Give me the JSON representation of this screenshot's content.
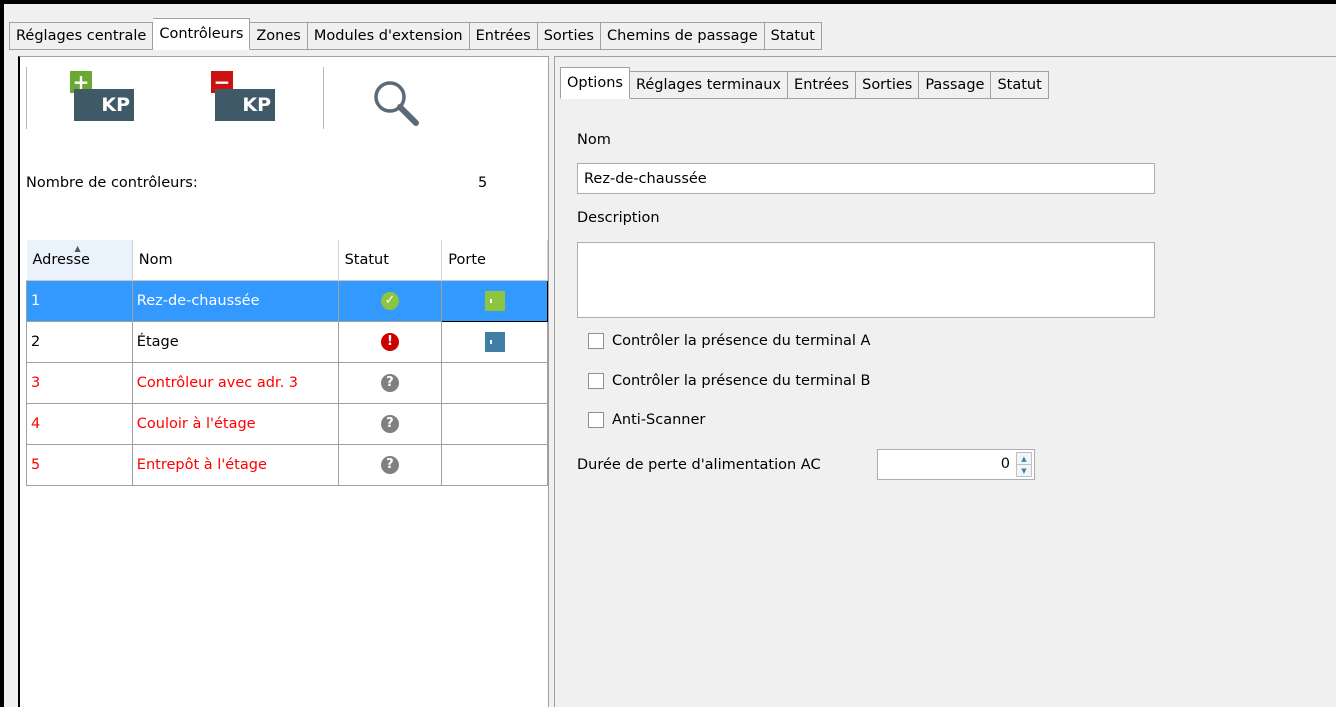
{
  "top_tabs": [
    {
      "label": "Réglages centrale"
    },
    {
      "label": "Contrôleurs"
    },
    {
      "label": "Zones"
    },
    {
      "label": "Modules d'extension"
    },
    {
      "label": "Entrées"
    },
    {
      "label": "Sorties"
    },
    {
      "label": "Chemins de passage"
    },
    {
      "label": "Statut"
    }
  ],
  "toolbar": {
    "add_badge": "+",
    "remove_badge": "−",
    "kp_text": "KP",
    "add_icon": "add-keypad-icon",
    "remove_icon": "remove-keypad-icon",
    "search_icon": "magnifier-icon"
  },
  "controllers": {
    "count_label": "Nombre de contrôleurs:",
    "count_value": "5",
    "columns": [
      "Adresse",
      "Nom",
      "Statut",
      "Porte"
    ],
    "rows": [
      {
        "address": "1",
        "name": "Rez-de-chaussée",
        "status": "ok",
        "door": "open"
      },
      {
        "address": "2",
        "name": "Étage",
        "status": "error",
        "door": "closed"
      },
      {
        "address": "3",
        "name": "Contrôleur avec adr. 3",
        "status": "unknown",
        "door": ""
      },
      {
        "address": "4",
        "name": "Couloir à l'étage",
        "status": "unknown",
        "door": ""
      },
      {
        "address": "5",
        "name": "Entrepôt à l'étage",
        "status": "unknown",
        "door": ""
      }
    ]
  },
  "sub_tabs": [
    {
      "label": "Options"
    },
    {
      "label": "Réglages terminaux"
    },
    {
      "label": "Entrées"
    },
    {
      "label": "Sorties"
    },
    {
      "label": "Passage"
    },
    {
      "label": "Statut"
    }
  ],
  "options": {
    "name_label": "Nom",
    "name_value": "Rez-de-chaussée",
    "description_label": "Description",
    "description_value": "",
    "check_terminal_a": "Contrôler la présence du terminal A",
    "check_terminal_b": "Contrôler la présence du terminal B",
    "anti_scanner": "Anti-Scanner",
    "ac_loss_label": "Durée de perte d'alimentation AC",
    "ac_loss_value": "0"
  },
  "colors": {
    "selection": "#3399ff",
    "offline_text": "#ff0000",
    "status_ok": "#8cc63f",
    "status_error": "#cc0000",
    "status_unknown": "#808080",
    "door_open": "#8cc63f",
    "door_closed": "#3f7fa6",
    "add_badge": "#6aa832",
    "remove_badge": "#cc1111",
    "kp_box": "#3f5a66"
  }
}
